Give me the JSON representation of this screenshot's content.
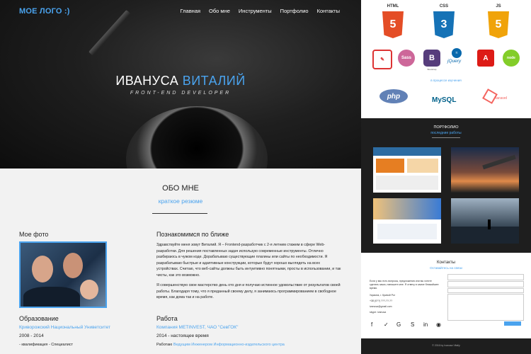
{
  "header": {
    "logo": "МОЕ ЛОГО :)",
    "nav": [
      "Главная",
      "Обо мне",
      "Инструменты",
      "Портфолио",
      "Контакты"
    ]
  },
  "hero": {
    "name_first": "ИВАНУСА",
    "name_last": "ВИТАЛИЙ",
    "subtitle": "FRONT-END DEVELOPER"
  },
  "about": {
    "title": "ОБО МНЕ",
    "subtitle": "краткое резюме",
    "photo_heading": "Мое фото",
    "intro_heading": "Познакомимся по ближе",
    "intro_p1": "Здравствуйте меня зовут Виталий. Я – Frontend-разработчик с 2-я летним стажем в сфере Web-разработки. Для решения поставленных задач использую современные инструменты. Отлично разбираюсь в чужом коде. Дорабатываю существующие плагины или сайты по необходимости. Я разрабатываю быстрые и адаптивные конструкции, которые будут хорошо выглядеть на всех устройствах. Считаю, что веб-сайты должны быть интуитивно понятными, просты в использовании, и так чисты, как это возможно.",
    "intro_p2": "Я совершенствую свое мастерство день ото дня и получаю истинное удовольствие от результатов своей работы. Благодаря тому, что я преданный своему делу, я занимаюсь программированием в свободное время, как дома так и на работе.",
    "education_heading": "Образование",
    "education_school": "Криворожский Национальный Униветситет",
    "education_years": "2008 - 2014",
    "education_detail": "- квалификация - Специалист",
    "work_heading": "Работа",
    "work_company": "Компания METINVEST, ЧАО \"СевГОК\"",
    "work_years": "2014 - настоящее время",
    "work_role_prefix": "Работаю",
    "work_role": "Ведущим Инженером Информационно-издательского центра"
  },
  "skills": {
    "html": "HTML",
    "css": "CSS",
    "js": "JS",
    "learning_label": "в процессе изучения",
    "php": "php",
    "mysql": "MySQL",
    "laravel": "laravel",
    "bootstrap": "Bootstrap",
    "jquery": "jQuery",
    "sass": "Sass",
    "angular": "A",
    "node": "node",
    "colors": {
      "html": "#e44d26",
      "css": "#1572b6",
      "js": "#f0a30a",
      "accent": "#4aa3ee"
    }
  },
  "portfolio": {
    "title": "ПОРТФОЛИО",
    "subtitle": "последние работы"
  },
  "contacts": {
    "title": "Контакты",
    "subtitle": "Оставайтесь на связи",
    "intro": "Если у вас есть вопросы, предложения или вы хотите сделать заказ, напишите мне. Я отвечу в самое ближайшее время.",
    "location": "Украина, г. Кривой Рог",
    "phone": "+38 (0??) ???-??-??",
    "email": "ivanusa@gmail.com",
    "skype": "skype: ivanusa",
    "footer": "© 2016 by Ivanusa Vitaliy"
  }
}
